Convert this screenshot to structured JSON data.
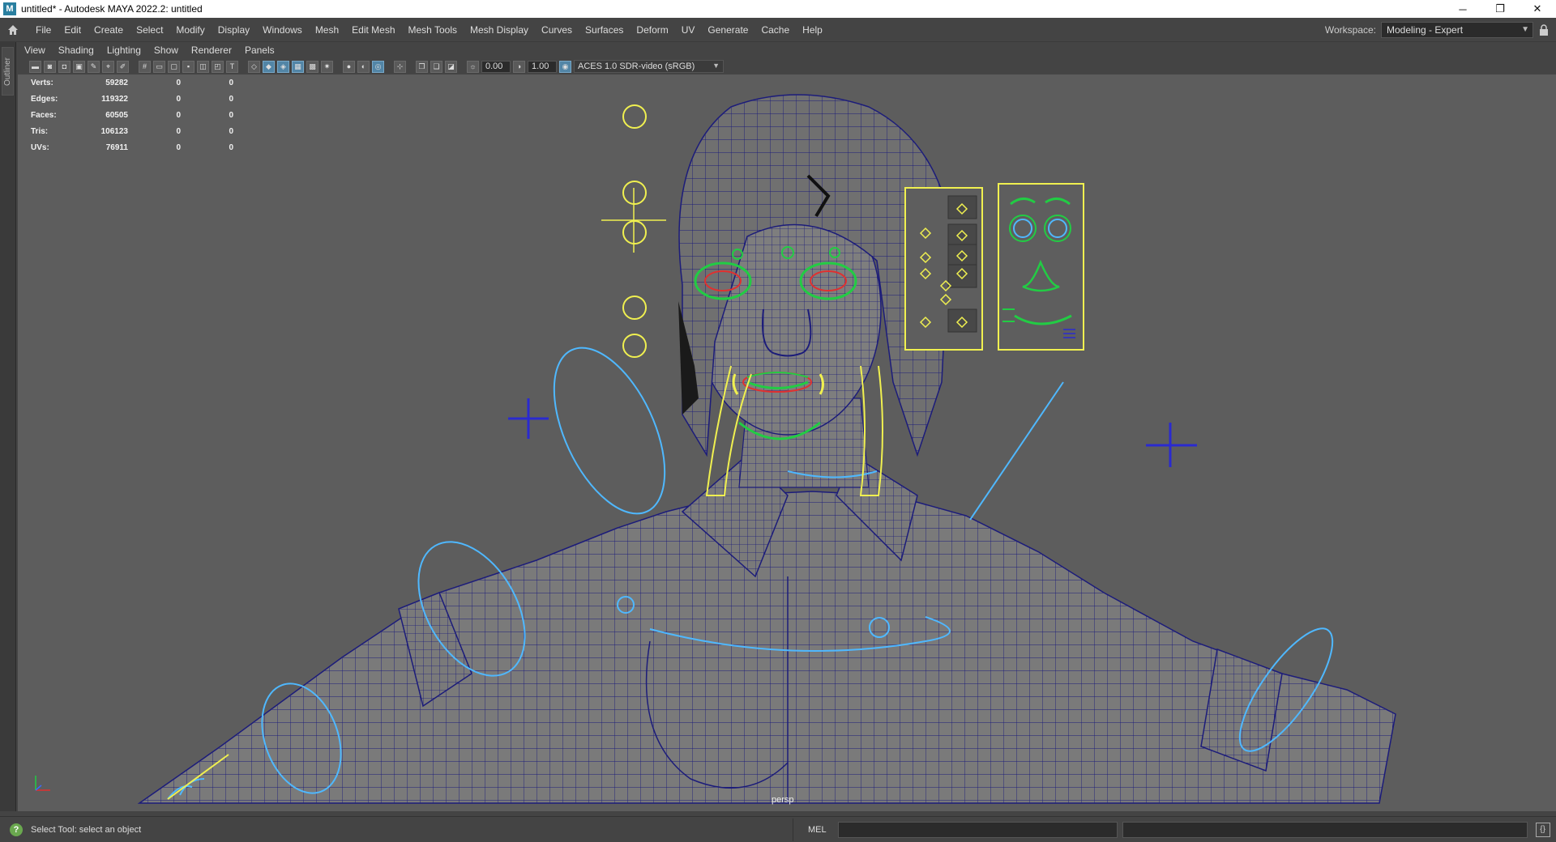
{
  "titlebar": {
    "app_icon": "M",
    "title": "untitled* - Autodesk MAYA 2022.2: untitled",
    "minimize": "─",
    "maximize": "❐",
    "close": "✕"
  },
  "menubar": {
    "items": [
      "File",
      "Edit",
      "Create",
      "Select",
      "Modify",
      "Display",
      "Windows",
      "Mesh",
      "Edit Mesh",
      "Mesh Tools",
      "Mesh Display",
      "Curves",
      "Surfaces",
      "Deform",
      "UV",
      "Generate",
      "Cache",
      "Help"
    ],
    "workspace_label": "Workspace:",
    "workspace_value": "Modeling - Expert"
  },
  "leftstrip": {
    "outliner_tab": "Outliner"
  },
  "panel_menu": {
    "items": [
      "View",
      "Shading",
      "Lighting",
      "Show",
      "Renderer",
      "Panels"
    ]
  },
  "toolbar": {
    "exposure": "0.00",
    "gamma": "1.00",
    "color_space": "ACES 1.0 SDR-video (sRGB)"
  },
  "hud": {
    "rows": [
      {
        "label": "Verts:",
        "v1": "59282",
        "v2": "0",
        "v3": "0"
      },
      {
        "label": "Edges:",
        "v1": "119322",
        "v2": "0",
        "v3": "0"
      },
      {
        "label": "Faces:",
        "v1": "60505",
        "v2": "0",
        "v3": "0"
      },
      {
        "label": "Tris:",
        "v1": "106123",
        "v2": "0",
        "v3": "0"
      },
      {
        "label": "UVs:",
        "v1": "76911",
        "v2": "0",
        "v3": "0"
      }
    ]
  },
  "viewport": {
    "camera_label": "persp"
  },
  "statusbar": {
    "help_text": "Select Tool: select an object",
    "mel_label": "MEL"
  },
  "colors": {
    "viewport_bg": "#5d5d5d",
    "wire": "#1c1c7a",
    "ctrl_yellow": "#f0f050",
    "ctrl_cyan": "#4fb8ff",
    "ctrl_green": "#22cc44",
    "ctrl_red": "#e03030"
  }
}
